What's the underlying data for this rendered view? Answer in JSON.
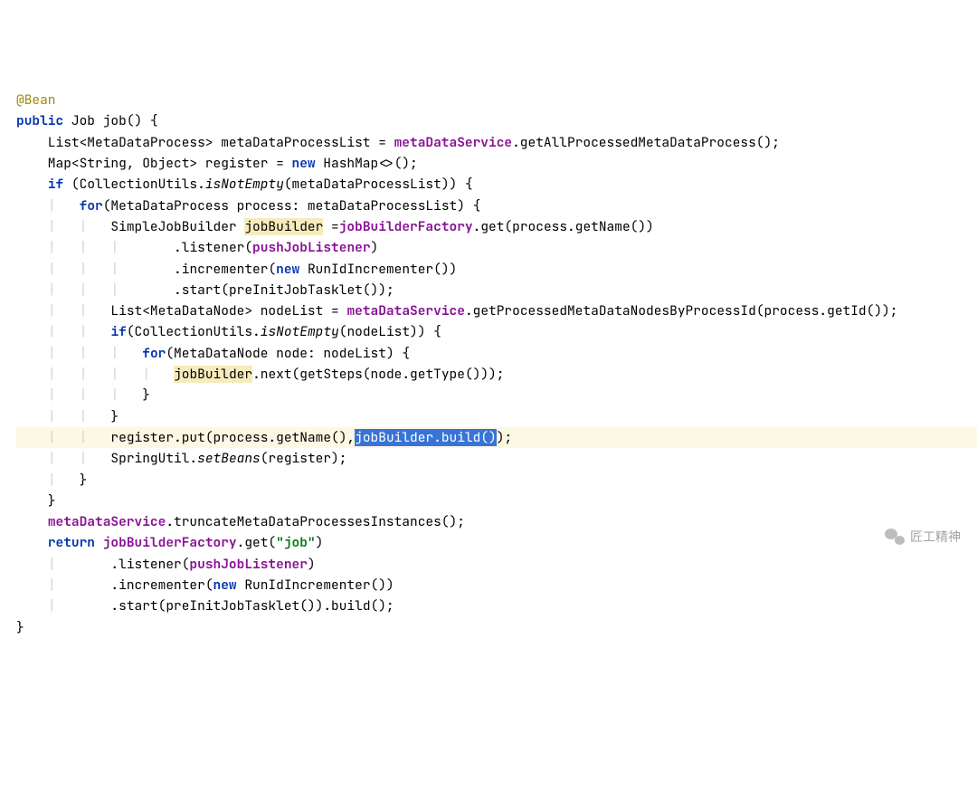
{
  "lines": [
    {
      "html": "<span class='ann'>@Bean</span>"
    },
    {
      "html": "<span class='kw'>public</span> Job job() {"
    },
    {
      "html": "    List&lt;MetaDataProcess&gt; metaDataProcessList = <span class='field'>metaDataService</span>.getAllProcessedMetaDataProcess();"
    },
    {
      "html": "    Map&lt;String, Object&gt; register = <span class='kw'>new</span> HashMap&lt;&gt;();"
    },
    {
      "html": "    <span class='kw'>if</span> (CollectionUtils.<span class='stat'>isNotEmpty</span>(metaDataProcessList)) {"
    },
    {
      "html": "    <span class='guide'>|</span>   <span class='kw'>for</span>(MetaDataProcess process: metaDataProcessList) {"
    },
    {
      "html": "    <span class='guide'>|</span>   <span class='guide'>|</span>   SimpleJobBuilder <span class='warn'>jobBuilder</span> =<span class='field'>jobBuilderFactory</span>.get(process.getName())"
    },
    {
      "html": "    <span class='guide'>|</span>   <span class='guide'>|</span>   <span class='guide'>|</span>       .listener(<span class='field'>pushJobListener</span>)"
    },
    {
      "html": "    <span class='guide'>|</span>   <span class='guide'>|</span>   <span class='guide'>|</span>       .incrementer(<span class='kw'>new</span> RunIdIncrementer())"
    },
    {
      "html": "    <span class='guide'>|</span>   <span class='guide'>|</span>   <span class='guide'>|</span>       .start(preInitJobTasklet());"
    },
    {
      "html": "    <span class='guide'>|</span>   <span class='guide'>|</span>   List&lt;MetaDataNode&gt; nodeList = <span class='field'>metaDataService</span>.getProcessedMetaDataNodesByProcessId(process.getId());"
    },
    {
      "html": "    <span class='guide'>|</span>   <span class='guide'>|</span>   <span class='kw'>if</span>(CollectionUtils.<span class='stat'>isNotEmpty</span>(nodeList)) {"
    },
    {
      "html": "    <span class='guide'>|</span>   <span class='guide'>|</span>   <span class='guide'>|</span>   <span class='kw'>for</span>(MetaDataNode node: nodeList) {"
    },
    {
      "html": "    <span class='guide'>|</span>   <span class='guide'>|</span>   <span class='guide'>|</span>   <span class='guide'>|</span>   <span class='warn'>jobBuilder</span>.next(getSteps(node.getType()));"
    },
    {
      "html": "    <span class='guide'>|</span>   <span class='guide'>|</span>   <span class='guide'>|</span>   }"
    },
    {
      "html": "    <span class='guide'>|</span>   <span class='guide'>|</span>   }"
    },
    {
      "html": "    <span class='guide'>|</span>   <span class='guide'>|</span>   register.put(process.getName(),<span class='sel'>jobBuilder.build()</span>);",
      "highlighted": true
    },
    {
      "html": "    <span class='guide'>|</span>   <span class='guide'>|</span>   SpringUtil.<span class='stat'>setBeans</span>(register);"
    },
    {
      "html": "    <span class='guide'>|</span>   }"
    },
    {
      "html": "    }"
    },
    {
      "html": "    <span class='field'>metaDataService</span>.truncateMetaDataProcessesInstances();"
    },
    {
      "html": "    <span class='kw'>return</span> <span class='field'>jobBuilderFactory</span>.get(<span class='str'>\"job\"</span>)"
    },
    {
      "html": "    <span class='guide'>|</span>       .listener(<span class='field'>pushJobListener</span>)"
    },
    {
      "html": "    <span class='guide'>|</span>       .incrementer(<span class='kw'>new</span> RunIdIncrementer())"
    },
    {
      "html": "    <span class='guide'>|</span>       .start(preInitJobTasklet()).build();"
    },
    {
      "html": "}"
    }
  ],
  "watermark": "匠工精神"
}
